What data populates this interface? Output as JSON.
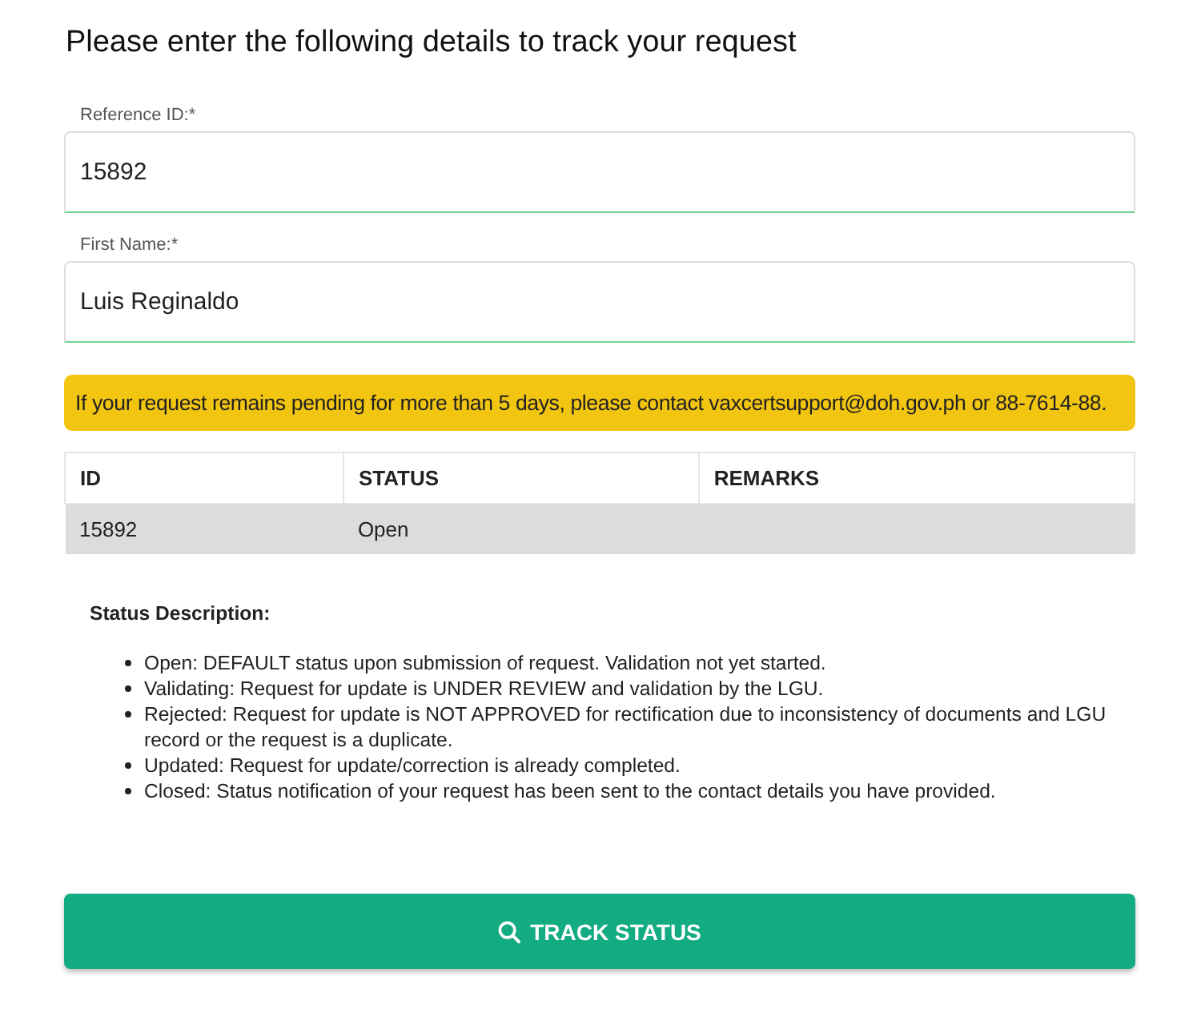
{
  "title": "Please enter the following details to track your request",
  "fields": [
    {
      "label": "Reference ID:*",
      "value": "15892"
    },
    {
      "label": "First Name:*",
      "value": "Luis Reginaldo"
    }
  ],
  "notice": "If your request remains pending for more than 5 days, please contact vaxcertsupport@doh.gov.ph or 88-7614-88.",
  "table": {
    "columns": [
      "ID",
      "STATUS",
      "REMARKS"
    ],
    "rows": [
      [
        "15892",
        "Open",
        ""
      ]
    ]
  },
  "status_description": {
    "heading": "Status Description:",
    "items": [
      "Open: DEFAULT status upon submission of request. Validation not yet started.",
      "Validating: Request for update is UNDER REVIEW and validation by the LGU.",
      "Rejected: Request for update is NOT APPROVED for rectification due to inconsistency of documents and LGU record or the request is a duplicate.",
      "Updated: Request for update/correction is already completed.",
      "Closed: Status notification of your request has been sent to the contact details you have provided."
    ]
  },
  "button": "TRACK STATUS"
}
